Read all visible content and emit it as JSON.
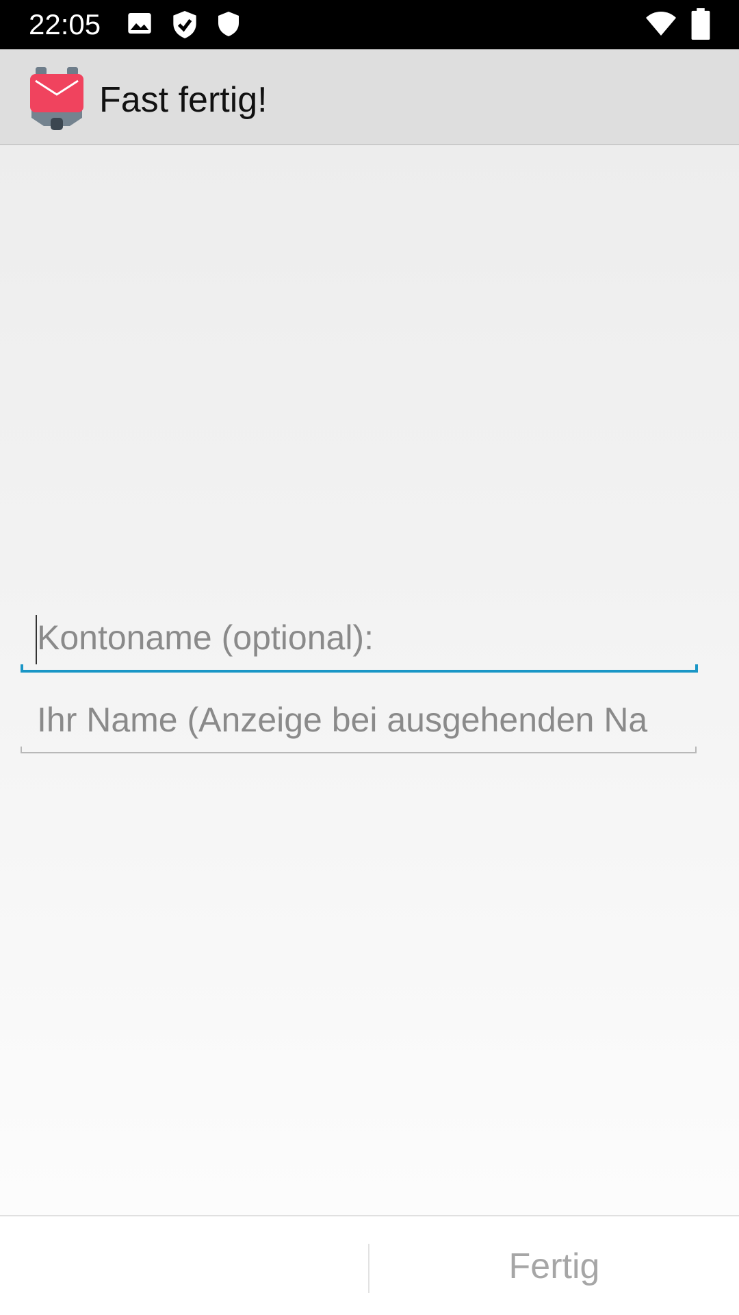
{
  "status_bar": {
    "time": "22:05",
    "icons": [
      "image-icon",
      "shield-check-icon",
      "shield-icon",
      "wifi-icon",
      "battery-icon"
    ]
  },
  "app_bar": {
    "title": "Fast fertig!",
    "logo": "k9-mail-logo-icon"
  },
  "form": {
    "account_name": {
      "placeholder": "Kontoname (optional):",
      "value": ""
    },
    "your_name": {
      "placeholder": "Ihr Name (Anzeige bei ausgehenden Na",
      "value": ""
    }
  },
  "footer": {
    "done_label": "Fertig"
  },
  "colors": {
    "accent": "#1a96c6",
    "logo_red": "#f0435e",
    "app_bar": "#dedede"
  }
}
